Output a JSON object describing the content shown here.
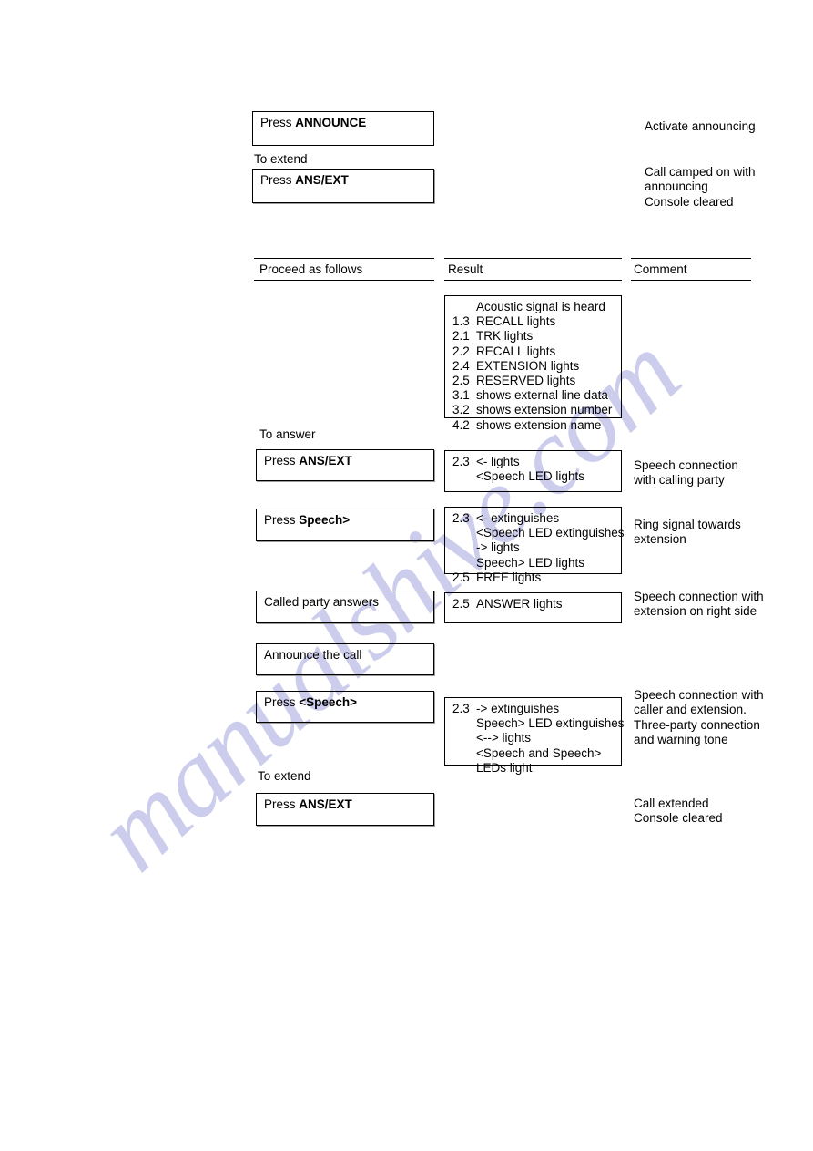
{
  "document": {
    "watermark_text": "manualshive.com",
    "watermark_color": "#ccccec"
  },
  "top_section": {
    "step1": {
      "prefix": "Press ",
      "key": "ANNOUNCE",
      "comment": "Activate announcing"
    },
    "to_extend_label": "To extend",
    "step2": {
      "prefix": "Press ",
      "key": "ANS/EXT",
      "comment_line1": "Call camped on with",
      "comment_line2": "announcing",
      "comment_line3": "Console cleared"
    }
  },
  "table": {
    "headers": {
      "procedure": "Proceed as follows",
      "result": "Result",
      "comment": "Comment"
    },
    "initial_result": {
      "lines": [
        {
          "code": "",
          "text": "Acoustic signal is heard"
        },
        {
          "code": "1.3",
          "text": "RECALL lights"
        },
        {
          "code": "2.1",
          "text": "TRK lights"
        },
        {
          "code": "2.2",
          "text": "RECALL lights"
        },
        {
          "code": "2.4",
          "text": "EXTENSION lights"
        },
        {
          "code": "2.5",
          "text": "RESERVED lights"
        },
        {
          "code": "3.1",
          "text": "shows external line data"
        },
        {
          "code": "3.2",
          "text": "shows extension number"
        },
        {
          "code": "4.2",
          "text": "shows extension name"
        }
      ]
    },
    "to_answer_label": "To answer",
    "rows": [
      {
        "action_prefix": "Press ",
        "action_key": "ANS/EXT",
        "result_lines": [
          {
            "code": "2.3",
            "text": "<- lights"
          },
          {
            "code": "",
            "text": "<Speech LED lights"
          }
        ],
        "comment_lines": [
          "Speech connection",
          "with calling party"
        ]
      },
      {
        "action_prefix": "Press ",
        "action_key": "Speech>",
        "result_lines": [
          {
            "code": "2.3",
            "text": "<- extinguishes"
          },
          {
            "code": "",
            "text": "<Speech LED extinguishes"
          },
          {
            "code": "",
            "text": "-> lights"
          },
          {
            "code": "",
            "text": "Speech> LED lights"
          },
          {
            "code": "2.5",
            "text": "FREE lights"
          }
        ],
        "comment_lines": [
          "Ring signal towards",
          "extension"
        ]
      },
      {
        "action_prefix": "Called party answers",
        "action_key": "",
        "result_lines": [
          {
            "code": "2.5",
            "text": "ANSWER lights"
          }
        ],
        "comment_lines": [
          "Speech connection with",
          "extension on right side"
        ]
      },
      {
        "action_prefix": "Announce the call",
        "action_key": "",
        "result_lines": [],
        "comment_lines": []
      },
      {
        "action_prefix": "Press ",
        "action_key": "<Speech>",
        "result_lines": [
          {
            "code": "2.3",
            "text": "-> extinguishes"
          },
          {
            "code": "",
            "text": "Speech> LED extinguishes"
          },
          {
            "code": "",
            "text": "<--> lights"
          },
          {
            "code": "",
            "text": "<Speech and Speech>"
          },
          {
            "code": "",
            "text": "LEDs light"
          }
        ],
        "comment_lines": [
          "Speech connection with",
          "caller and extension.",
          "Three-party connection",
          "and warning tone"
        ]
      }
    ],
    "to_extend_label": "To extend",
    "final_row": {
      "action_prefix": "Press ",
      "action_key": "ANS/EXT",
      "comment_lines": [
        "Call extended",
        "Console cleared"
      ]
    }
  }
}
